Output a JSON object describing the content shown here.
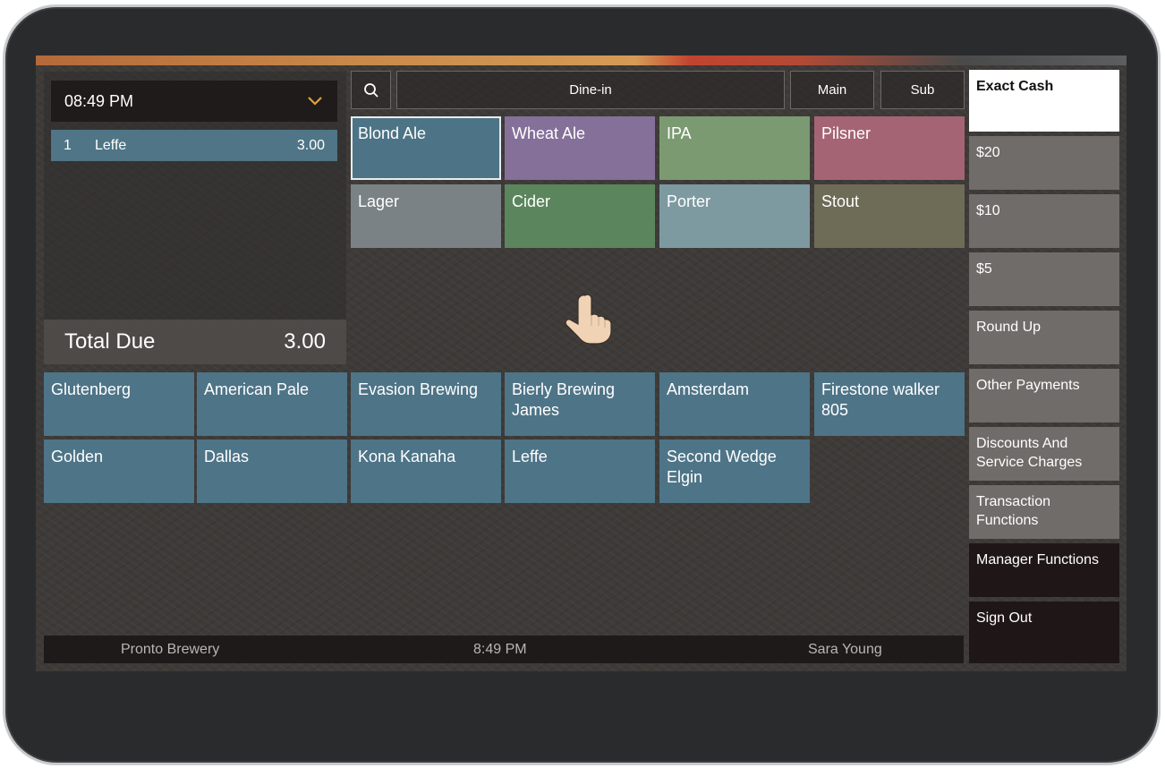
{
  "header": {
    "time": "08:49 PM"
  },
  "check": {
    "items": [
      {
        "qty": "1",
        "name": "Leffe",
        "price": "3.00"
      }
    ],
    "total_label": "Total Due",
    "total_value": "3.00"
  },
  "toolbar": {
    "order_type": "Dine-in",
    "main_label": "Main",
    "sub_label": "Sub"
  },
  "categories": [
    {
      "label": "Blond Ale",
      "color": "#4d7486"
    },
    {
      "label": "Wheat Ale",
      "color": "#85709a"
    },
    {
      "label": "IPA",
      "color": "#7c9a72"
    },
    {
      "label": "Pilsner",
      "color": "#a56474"
    },
    {
      "label": "Lager",
      "color": "#7a8285"
    },
    {
      "label": "Cider",
      "color": "#5b865d"
    },
    {
      "label": "Porter",
      "color": "#7d9aa0"
    },
    {
      "label": "Stout",
      "color": "#6e6c57"
    }
  ],
  "items": [
    {
      "label": "Glutenberg"
    },
    {
      "label": "American Pale"
    },
    {
      "label": "Evasion Brewing"
    },
    {
      "label": "Bierly Brewing James"
    },
    {
      "label": "Amsterdam"
    },
    {
      "label": "Firestone walker 805"
    },
    {
      "label": "Golden"
    },
    {
      "label": "Dallas"
    },
    {
      "label": "Kona Kanaha"
    },
    {
      "label": "Leffe"
    },
    {
      "label": "Second Wedge Elgin"
    }
  ],
  "item_color": "#4e7487",
  "payments": [
    {
      "label": "Exact Cash"
    },
    {
      "label": "$20"
    },
    {
      "label": "$10"
    },
    {
      "label": "$5"
    },
    {
      "label": "Round Up"
    },
    {
      "label": "Other Payments"
    },
    {
      "label": "Discounts And Service Charges"
    },
    {
      "label": "Transaction Functions"
    },
    {
      "label": "Manager Functions"
    },
    {
      "label": "Sign Out"
    }
  ],
  "footer": {
    "location": "Pronto Brewery",
    "time": "8:49 PM",
    "employee": "Sara Young"
  }
}
